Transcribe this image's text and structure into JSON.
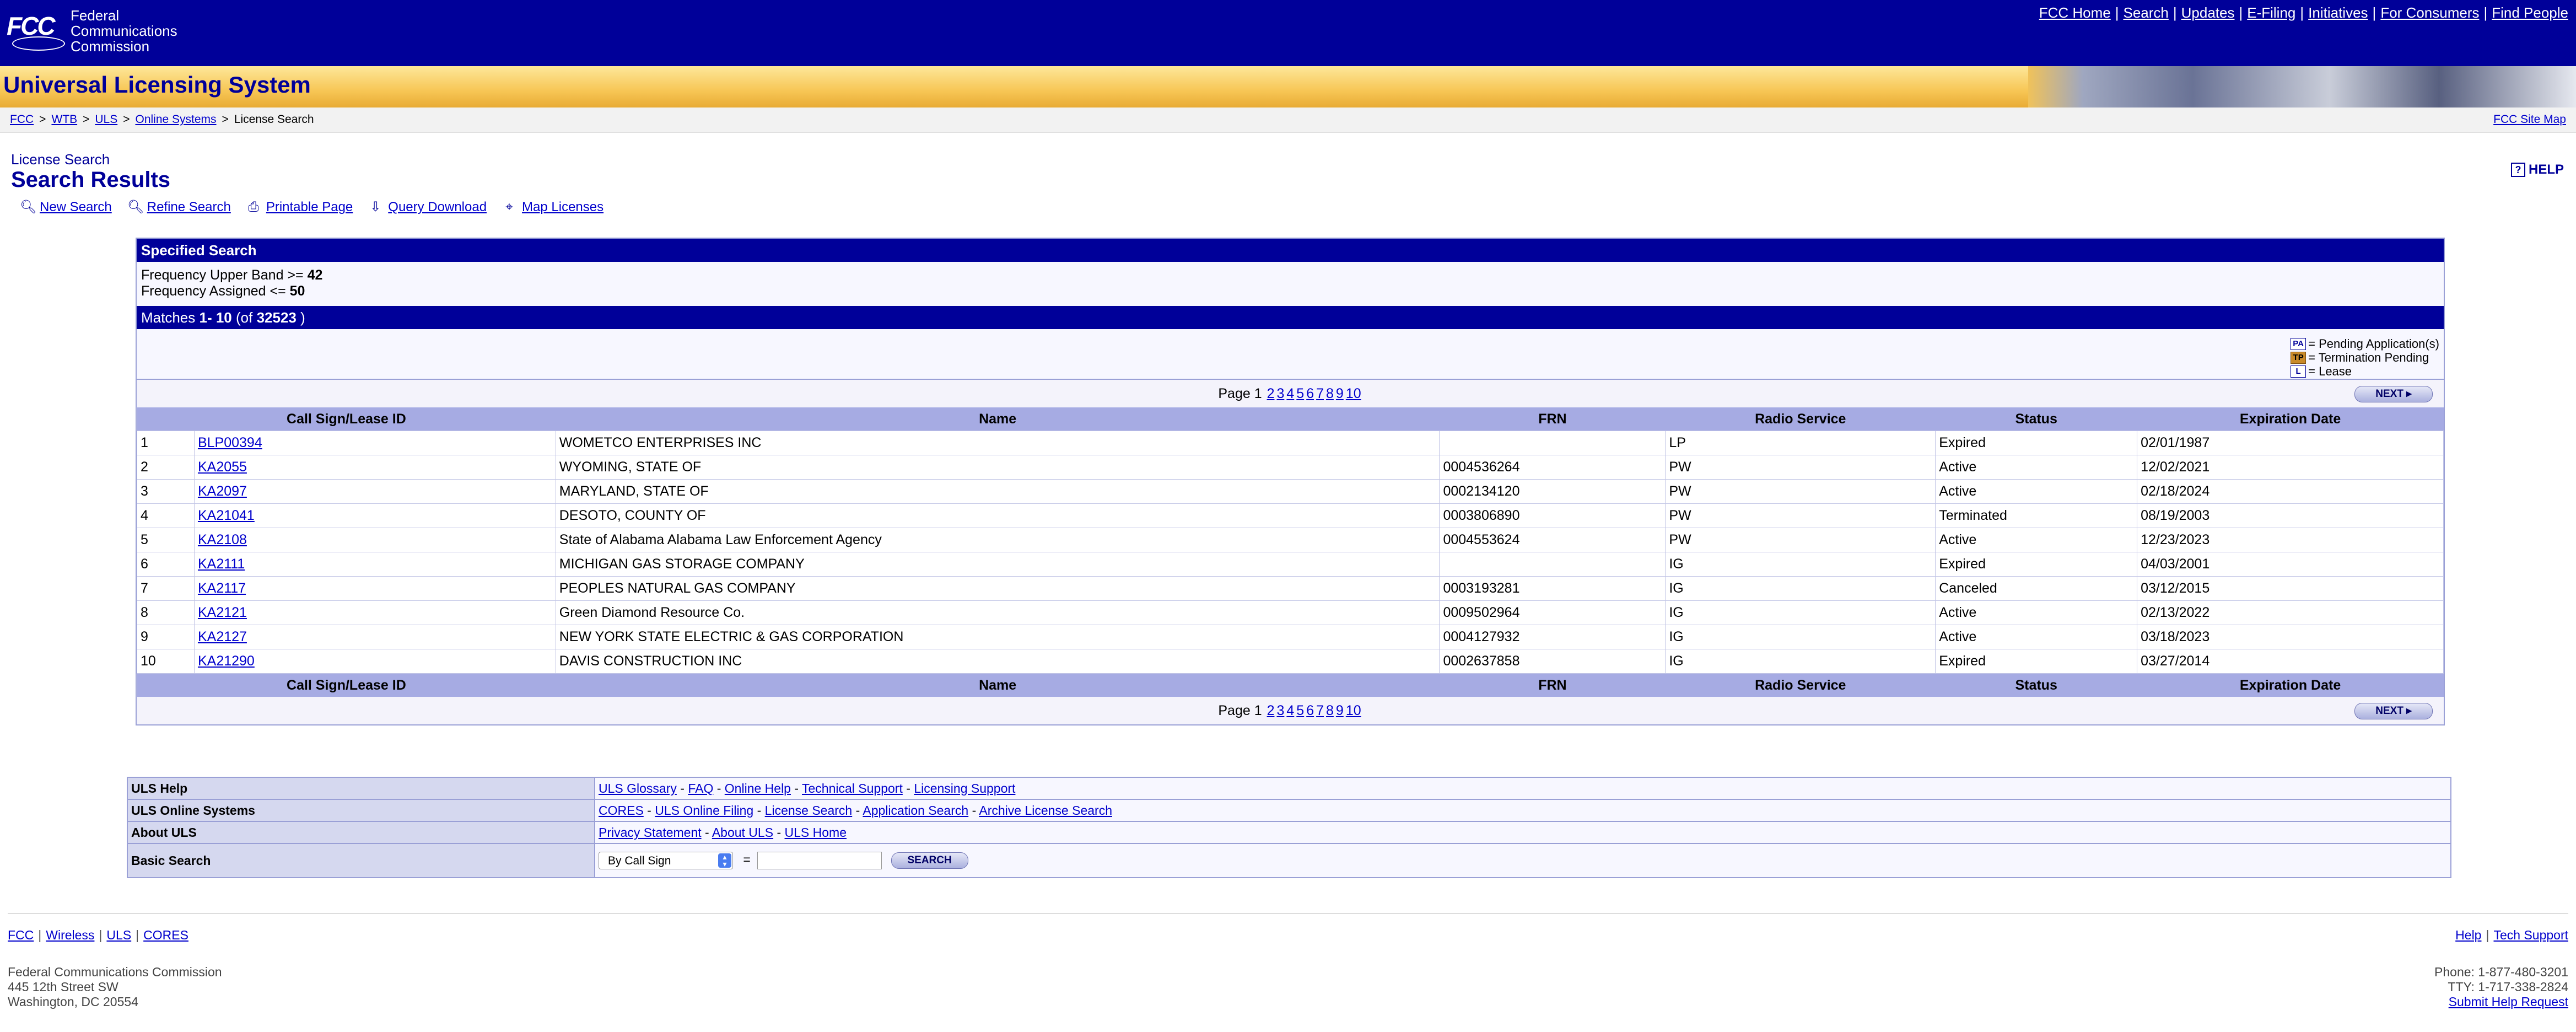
{
  "header": {
    "agency_lines": [
      "Federal",
      "Communications",
      "Commission"
    ],
    "nav": [
      "FCC Home",
      "Search",
      "Updates",
      "E-Filing",
      "Initiatives",
      "For Consumers",
      "Find People"
    ]
  },
  "titleband": {
    "system_name": "Universal Licensing System"
  },
  "breadcrumb": {
    "items": [
      "FCC",
      "WTB",
      "ULS",
      "Online Systems"
    ],
    "current": "License Search",
    "site_map": "FCC Site Map"
  },
  "page": {
    "subtitle": "License Search",
    "title": "Search Results",
    "help_icon": "?",
    "help_label": "HELP"
  },
  "tools": [
    "New Search",
    "Refine Search",
    "Printable Page",
    "Query Download",
    "Map Licenses"
  ],
  "specified_search": {
    "heading": "Specified Search",
    "criteria": [
      {
        "label": "Frequency Upper Band >= ",
        "value": "42"
      },
      {
        "label": "Frequency Assigned <= ",
        "value": "50"
      }
    ]
  },
  "matches": {
    "prefix": "Matches ",
    "range": "1- 10",
    "of_prefix": " (of ",
    "total": "32523",
    "suffix": " )"
  },
  "legend": [
    {
      "code": "PA",
      "label": "= Pending Application(s)"
    },
    {
      "code": "TP",
      "label": "= Termination Pending"
    },
    {
      "code": "L",
      "label": "= Lease"
    }
  ],
  "pager": {
    "label": "Page",
    "current": "1",
    "pages": [
      "2",
      "3",
      "4",
      "5",
      "6",
      "7",
      "8",
      "9",
      "10"
    ],
    "next": "NEXT ▸"
  },
  "table": {
    "columns": [
      "Call Sign/Lease ID",
      "Name",
      "FRN",
      "Radio Service",
      "Status",
      "Expiration Date"
    ],
    "rows": [
      {
        "n": "1",
        "call": "BLP00394",
        "name": "WOMETCO ENTERPRISES INC",
        "frn": "",
        "svc": "LP",
        "status": "Expired",
        "exp": "02/01/1987"
      },
      {
        "n": "2",
        "call": "KA2055",
        "name": "WYOMING, STATE OF",
        "frn": "0004536264",
        "svc": "PW",
        "status": "Active",
        "exp": "12/02/2021"
      },
      {
        "n": "3",
        "call": "KA2097",
        "name": "MARYLAND, STATE OF",
        "frn": "0002134120",
        "svc": "PW",
        "status": "Active",
        "exp": "02/18/2024"
      },
      {
        "n": "4",
        "call": "KA21041",
        "name": "DESOTO, COUNTY OF",
        "frn": "0003806890",
        "svc": "PW",
        "status": "Terminated",
        "exp": "08/19/2003"
      },
      {
        "n": "5",
        "call": "KA2108",
        "name": "State of Alabama Alabama Law Enforcement Agency",
        "frn": "0004553624",
        "svc": "PW",
        "status": "Active",
        "exp": "12/23/2023"
      },
      {
        "n": "6",
        "call": "KA2111",
        "name": "MICHIGAN GAS STORAGE COMPANY",
        "frn": "",
        "svc": "IG",
        "status": "Expired",
        "exp": "04/03/2001"
      },
      {
        "n": "7",
        "call": "KA2117",
        "name": "PEOPLES NATURAL GAS COMPANY",
        "frn": "0003193281",
        "svc": "IG",
        "status": "Canceled",
        "exp": "03/12/2015"
      },
      {
        "n": "8",
        "call": "KA2121",
        "name": "Green Diamond Resource Co.",
        "frn": "0009502964",
        "svc": "IG",
        "status": "Active",
        "exp": "02/13/2022"
      },
      {
        "n": "9",
        "call": "KA2127",
        "name": "NEW YORK STATE ELECTRIC & GAS CORPORATION",
        "frn": "0004127932",
        "svc": "IG",
        "status": "Active",
        "exp": "03/18/2023"
      },
      {
        "n": "10",
        "call": "KA21290",
        "name": "DAVIS CONSTRUCTION INC",
        "frn": "0002637858",
        "svc": "IG",
        "status": "Expired",
        "exp": "03/27/2014"
      }
    ]
  },
  "info": {
    "rows": [
      {
        "label": "ULS Help",
        "links": [
          "ULS Glossary",
          "FAQ",
          "Online Help",
          "Technical Support",
          "Licensing Support"
        ]
      },
      {
        "label": "ULS Online Systems",
        "links": [
          "CORES",
          "ULS Online Filing",
          "License Search",
          "Application Search",
          "Archive License Search"
        ]
      },
      {
        "label": "About ULS",
        "links": [
          "Privacy Statement",
          "About ULS",
          "ULS Home"
        ]
      }
    ],
    "basic_search": {
      "label": "Basic Search",
      "select_value": "By Call Sign",
      "equals": "=",
      "button": "SEARCH"
    }
  },
  "footer": {
    "links": [
      "FCC",
      "Wireless",
      "ULS",
      "CORES"
    ],
    "right_links": [
      "Help",
      "Tech Support"
    ],
    "address": [
      "Federal Communications Commission",
      "445 12th Street SW",
      "Washington, DC 20554"
    ],
    "phone": "Phone: 1-877-480-3201",
    "tty": "TTY: 1-717-338-2824",
    "submit": "Submit Help Request"
  },
  "colors": {
    "fcc_blue": "#000099",
    "table_header": "#a6abe3",
    "title_gold": "#f7c655"
  }
}
